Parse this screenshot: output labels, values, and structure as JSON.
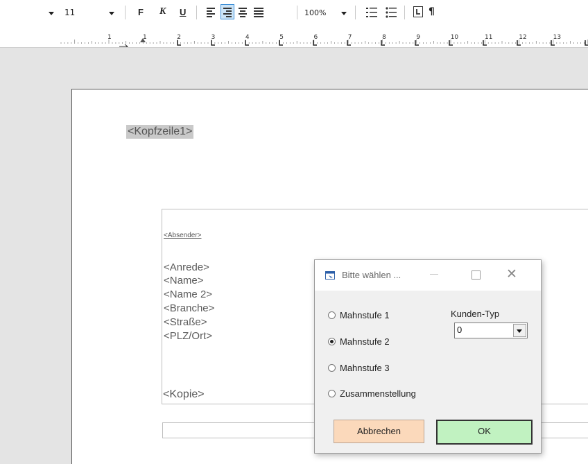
{
  "toolbar": {
    "font_size": "11",
    "bold_label": "F",
    "italic_label": "K",
    "underline_label": "U",
    "zoom": "100%"
  },
  "ruler": {
    "numbers": [
      "1",
      "1",
      "2",
      "3",
      "4",
      "5",
      "6",
      "7",
      "8",
      "9",
      "10",
      "11",
      "12",
      "13"
    ]
  },
  "document": {
    "header_field": "<Kopfzeile1>",
    "sender_field": "<Absender>",
    "address_lines": [
      "<Anrede>",
      "<Name>",
      "<Name 2>",
      "<Branche>",
      "<Straße>",
      "<PLZ/Ort>"
    ],
    "copy_field": "<Kopie>"
  },
  "dialog": {
    "title": "Bitte wählen ...",
    "options": [
      {
        "label": "Mahnstufe 1",
        "checked": false
      },
      {
        "label": "Mahnstufe 2",
        "checked": true
      },
      {
        "label": "Mahnstufe 3",
        "checked": false
      },
      {
        "label": "Zusammenstellung",
        "checked": false
      }
    ],
    "customer_type_label": "Kunden-Typ",
    "customer_type_value": "0",
    "cancel_label": "Abbrechen",
    "ok_label": "OK"
  },
  "colors": {
    "cancel_button": "#fbd9bb",
    "ok_button": "#c1f2c1",
    "active_align": "#cce4f7"
  }
}
